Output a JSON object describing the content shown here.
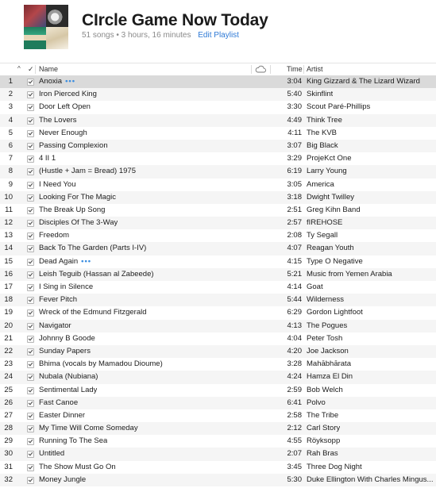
{
  "playlist": {
    "title": "CIrcle Game Now Today",
    "summary": "51 songs • 3 hours, 16 minutes",
    "edit_label": "Edit Playlist"
  },
  "columns": {
    "sort_indicator": "^",
    "check": "✓",
    "name": "Name",
    "cloud": "cloud-icon",
    "time": "Time",
    "artist": "Artist"
  },
  "selected_row": 1,
  "tracks": [
    {
      "n": "1",
      "name": "Anoxia",
      "more": true,
      "time": "3:04",
      "artist": "King Gizzard & The Lizard Wizard"
    },
    {
      "n": "2",
      "name": "Iron Pierced King",
      "time": "5:40",
      "artist": "Skinflint"
    },
    {
      "n": "3",
      "name": "Door Left Open",
      "time": "3:30",
      "artist": "Scout Paré-Phillips"
    },
    {
      "n": "4",
      "name": "The Lovers",
      "time": "4:49",
      "artist": "Think Tree"
    },
    {
      "n": "5",
      "name": "Never Enough",
      "time": "4:11",
      "artist": "The KVB"
    },
    {
      "n": "6",
      "name": "Passing Complexion",
      "time": "3:07",
      "artist": "Big Black"
    },
    {
      "n": "7",
      "name": "4 II 1",
      "time": "3:29",
      "artist": "ProjeKct One"
    },
    {
      "n": "8",
      "name": "(Hustle + Jam = Bread) 1975",
      "time": "6:19",
      "artist": "Larry Young"
    },
    {
      "n": "9",
      "name": "I Need You",
      "time": "3:05",
      "artist": "America"
    },
    {
      "n": "10",
      "name": "Looking For The Magic",
      "time": "3:18",
      "artist": "Dwight Twilley"
    },
    {
      "n": "11",
      "name": "The Break Up Song",
      "time": "2:51",
      "artist": "Greg Kihn Band"
    },
    {
      "n": "12",
      "name": "Disciples Of The 3-Way",
      "time": "2:57",
      "artist": "fIREHOSE"
    },
    {
      "n": "13",
      "name": "Freedom",
      "time": "2:08",
      "artist": "Ty Segall"
    },
    {
      "n": "14",
      "name": "Back To The Garden (Parts I-IV)",
      "time": "4:07",
      "artist": "Reagan Youth"
    },
    {
      "n": "15",
      "name": "Dead Again",
      "more": true,
      "time": "4:15",
      "artist": "Type O Negative"
    },
    {
      "n": "16",
      "name": "Leish Teguib (Hassan al Zabeede)",
      "time": "5:21",
      "artist": "Music from Yemen Arabia"
    },
    {
      "n": "17",
      "name": "I Sing in Silence",
      "time": "4:14",
      "artist": "Goat"
    },
    {
      "n": "18",
      "name": "Fever Pitch",
      "time": "5:44",
      "artist": "Wilderness"
    },
    {
      "n": "19",
      "name": "Wreck of the Edmund Fitzgerald",
      "time": "6:29",
      "artist": "Gordon Lightfoot"
    },
    {
      "n": "20",
      "name": "Navigator",
      "time": "4:13",
      "artist": "The Pogues"
    },
    {
      "n": "21",
      "name": "Johnny B Goode",
      "time": "4:04",
      "artist": "Peter Tosh"
    },
    {
      "n": "22",
      "name": "Sunday Papers",
      "time": "4:20",
      "artist": "Joe Jackson"
    },
    {
      "n": "23",
      "name": "Bhima (vocals by Mamadou Dioume)",
      "time": "3:28",
      "artist": "Mahābhārata"
    },
    {
      "n": "24",
      "name": "Nubala (Nubiana)",
      "time": "4:24",
      "artist": "Hamza El Din"
    },
    {
      "n": "25",
      "name": "Sentimental Lady",
      "time": "2:59",
      "artist": "Bob Welch"
    },
    {
      "n": "26",
      "name": "Fast Canoe",
      "time": "6:41",
      "artist": "Polvo"
    },
    {
      "n": "27",
      "name": "Easter Dinner",
      "time": "2:58",
      "artist": "The Tribe"
    },
    {
      "n": "28",
      "name": "My Time Will Come Someday",
      "time": "2:12",
      "artist": "Carl Story"
    },
    {
      "n": "29",
      "name": "Running To The Sea",
      "time": "4:55",
      "artist": "Röyksopp"
    },
    {
      "n": "30",
      "name": "Untitled",
      "time": "2:07",
      "artist": "Rah Bras"
    },
    {
      "n": "31",
      "name": "The Show Must Go On",
      "time": "3:45",
      "artist": "Three Dog Night"
    },
    {
      "n": "32",
      "name": "Money Jungle",
      "time": "5:30",
      "artist": "Duke Ellington With Charles Mingus..."
    }
  ]
}
